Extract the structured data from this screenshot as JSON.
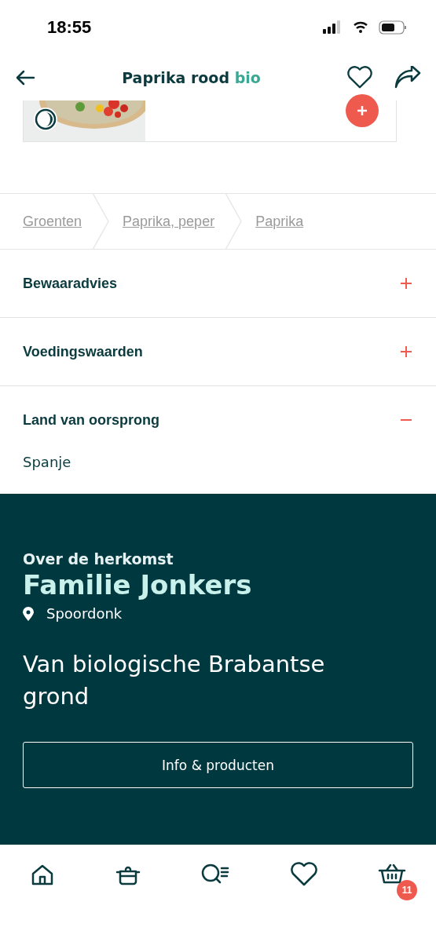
{
  "status_bar": {
    "time": "18:55"
  },
  "header": {
    "title": "Paprika rood",
    "label": "bio",
    "favorite": false
  },
  "breadcrumbs": [
    "Groenten",
    "Paprika, peper",
    "Paprika"
  ],
  "sections": [
    {
      "title": "Bewaaradvies",
      "expanded": false
    },
    {
      "title": "Voedingswaarden",
      "expanded": false
    },
    {
      "title": "Land van oorsprong",
      "expanded": true,
      "content": "Spanje"
    }
  ],
  "origin": {
    "eyebrow": "Over de herkomst",
    "name": "Familie Jonkers",
    "place": "Spoordonk",
    "tagline": "Van biologische Brabantse grond",
    "button": "Info & producten"
  },
  "nav": [
    {
      "kind": "home",
      "selected": false
    },
    {
      "kind": "recipes",
      "selected": false
    },
    {
      "kind": "search",
      "selected": false
    },
    {
      "kind": "favorites",
      "selected": false
    },
    {
      "kind": "basket",
      "selected": false,
      "badge": "11"
    }
  ]
}
